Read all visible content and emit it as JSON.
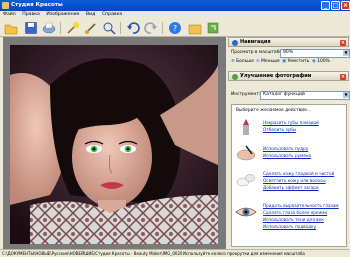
{
  "window": {
    "title": "Студия Красоты"
  },
  "menu": [
    "Файл",
    "Правка",
    "Изображение",
    "Вид",
    "Справка"
  ],
  "toolbar": {
    "icons": [
      "open-folder-icon",
      "save-icon",
      "print-icon",
      "magic-wand-icon",
      "brush-icon",
      "zoom-icon",
      "undo-icon",
      "redo-icon",
      "help-icon",
      "folder-icon",
      "export-icon"
    ]
  },
  "navigation": {
    "title": "Навигация",
    "zoom_label": "Просмотр в масштабе",
    "zoom_value": "90%",
    "btn_larger": "Больше",
    "btn_smaller": "Меньше",
    "btn_fit": "Уместить",
    "btn_100": "100%"
  },
  "enhance": {
    "title": "Улучшение фотографии",
    "tool_label": "Инструмент:",
    "tool_value": "Каталог функций",
    "choose_label": "Выберите желаемое действие...",
    "groups": [
      {
        "links": [
          "Накрасить губы помадой",
          "Отбелить зубы"
        ]
      },
      {
        "links": [
          "Использовать пудру",
          "Использовать румяна"
        ]
      },
      {
        "links": [
          "Сделать кожу гладкой и чистой",
          "Осветлить кожу или волосы",
          "Добавить эффект загара"
        ]
      },
      {
        "links": [
          "Придать выразительность глазам",
          "Сделать глаза более яркими",
          "Использовать тени для век",
          "Использовать подводку"
        ]
      }
    ]
  },
  "status": {
    "path": "C:\\ДОКУМЕНТЫ\\НОВЫЕ\\Русские\\НОВЕЙШИЕ\\Студия Красоты - Beauty Maker\\IMG_0029_Степ.jpg  600×549",
    "hint": "Используйте колесо прокрутки для изменения масштаба"
  },
  "colors": {
    "titlebar": "#0a5fd7",
    "close": "#d93a22",
    "link": "#0a2fc0",
    "nav_icon": "#2a6ad0",
    "enhance_icon": "#4aa04a"
  }
}
